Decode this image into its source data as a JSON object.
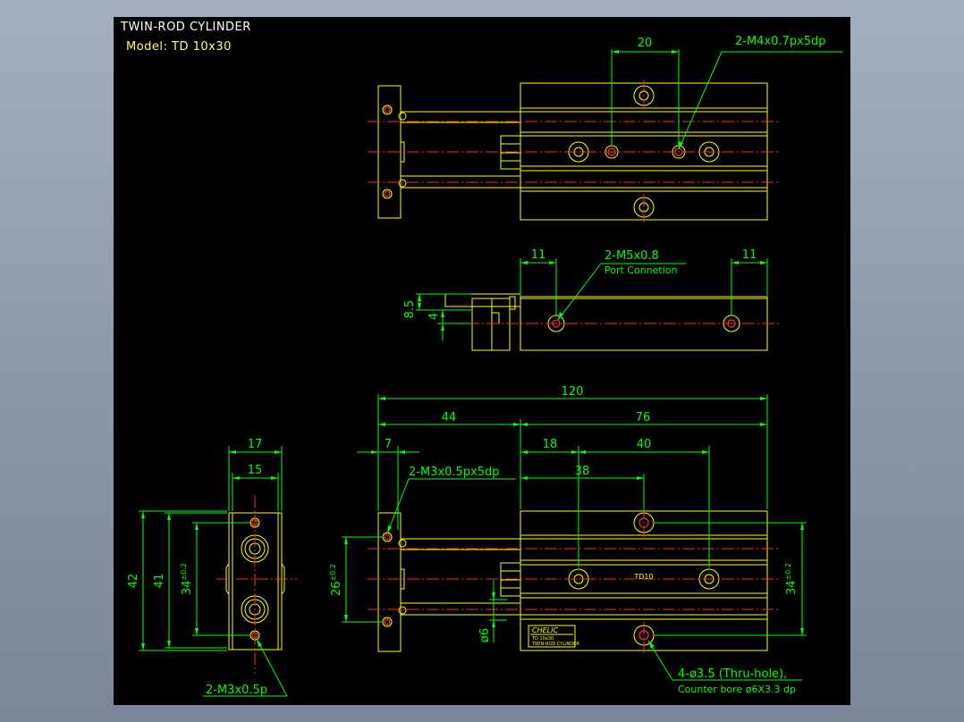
{
  "header": {
    "title": "TWIN-ROD CYLINDER",
    "model": "Model:  TD 10x30"
  },
  "dimensions": {
    "top_20": "20",
    "callout_m4": "2-M4x0.7px5dp",
    "left_11": "11",
    "right_11": "11",
    "callout_m5": "2-M5x0.8",
    "port_connection": "Port Connetion",
    "d_8_5": "8.5",
    "d_4": "4",
    "d_120": "120",
    "d_44": "44",
    "d_76": "76",
    "d_7": "7",
    "d_18": "18",
    "d_40": "40",
    "d_38": "38",
    "callout_m3_front": "2-M3x0.5px5dp",
    "d_26": "26",
    "tol_26": "±0.2",
    "d_6": "ø6",
    "d_34_right": "34",
    "tol_34_right": "±0.2",
    "callout_thru_hole": "4-ø3.5 (Thru-hole),",
    "counter_bore": "Counter bore ø6X3.3 dp",
    "d_17": "17",
    "d_15": "15",
    "d_42": "42",
    "d_41": "41",
    "d_34_end": "34",
    "tol_34_end": "±0.2",
    "callout_m3_end": "2-M3x0.5p"
  },
  "body_text": {
    "model_mark": "TD10",
    "brand": "CHELIC",
    "label_line1": "TD 10x30",
    "label_line2": "TWIN-ROD CYLINDER"
  },
  "colors": {
    "outline": "#ffff00",
    "dimension": "#00ff00",
    "centerline": "#ff2a2a",
    "background": "#000000",
    "title_text": "#ffffff",
    "model_text": "#ffff66"
  }
}
